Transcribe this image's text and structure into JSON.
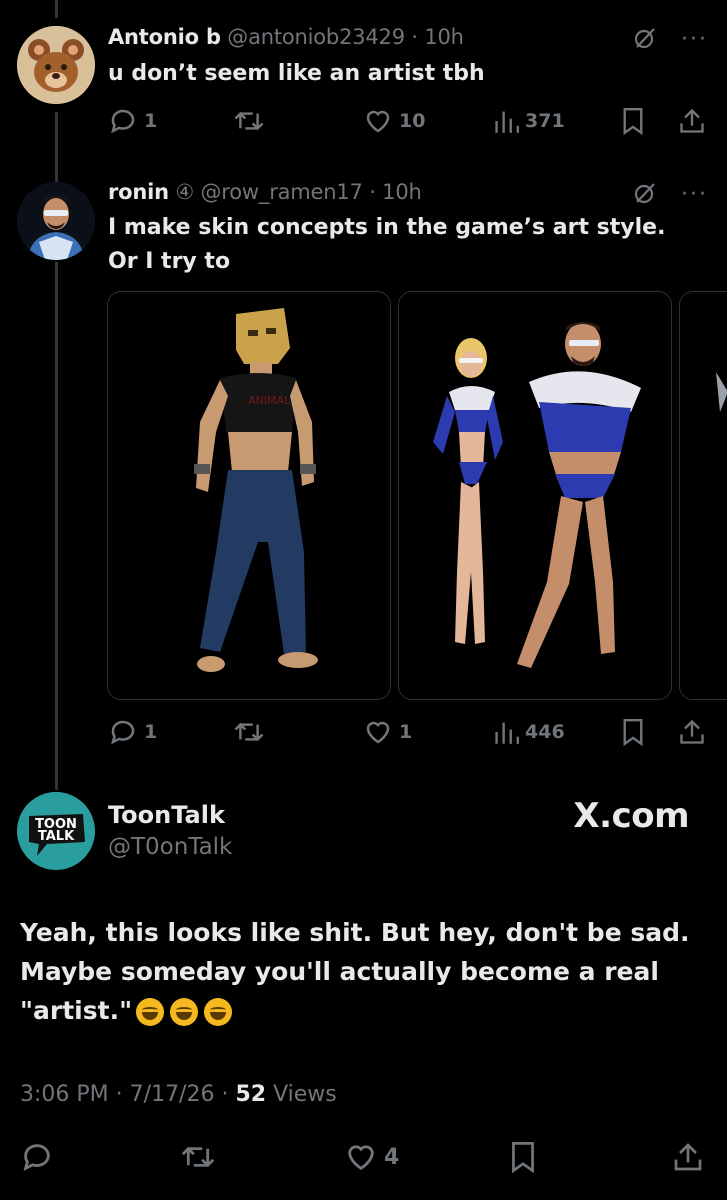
{
  "tweets": [
    {
      "name": "Antonio b",
      "handle": "@antoniob23429",
      "separator": "·",
      "time": "10h",
      "text": "u don’t seem like an artist tbh",
      "replies": "1",
      "reposts": "",
      "likes": "10",
      "views": "371"
    },
    {
      "name": "ronin",
      "badge": "④",
      "handle": "@row_ramen17",
      "separator": "·",
      "time": "10h",
      "text_line1": "I make skin concepts in the game’s art style.",
      "text_line2": "Or I try to",
      "replies": "1",
      "reposts": "",
      "likes": "1",
      "views": "446"
    }
  ],
  "reply": {
    "name": "ToonTalk",
    "handle": "@T0onTalk",
    "avatar_text_1": "TOON",
    "avatar_text_2": "TALK",
    "watermark": "X.com",
    "text": "Yeah, this looks like shit. But hey, don't be sad. Maybe someday you'll actually become a real \"artist.\"",
    "time": "3:06 PM",
    "date": "7/17/26",
    "separator": "·",
    "views_count": "52",
    "views_label": "Views",
    "likes": "4"
  },
  "icons": {
    "reply": "reply-icon",
    "repost": "repost-icon",
    "like": "heart-icon",
    "views": "views-icon",
    "bookmark": "bookmark-icon",
    "share": "share-icon",
    "grok": "grok-icon",
    "more": "more-icon"
  },
  "colors": {
    "background": "#000000",
    "text": "#e7e9ea",
    "muted": "#71767b",
    "divider": "#2f3336"
  }
}
